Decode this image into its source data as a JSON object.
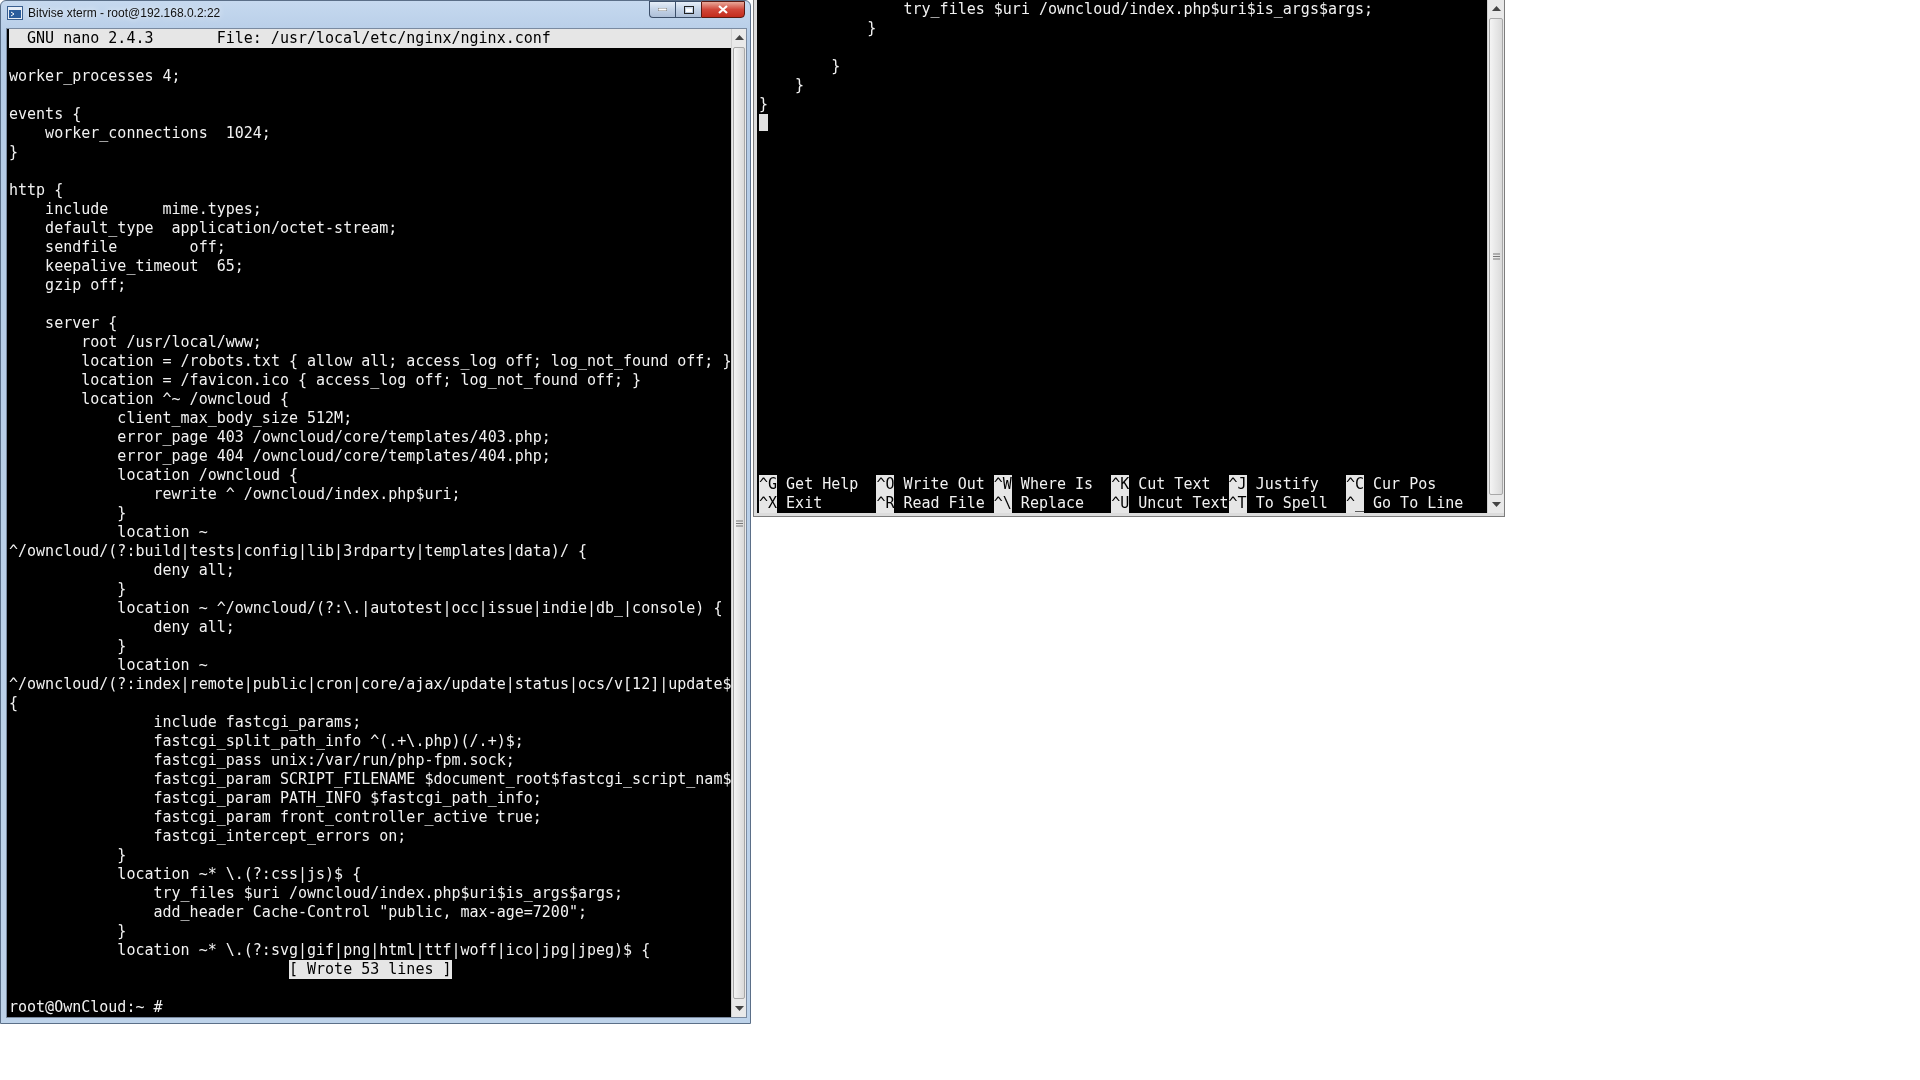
{
  "window": {
    "title": "Bitvise xterm - root@192.168.0.2:22"
  },
  "left_terminal": {
    "header": {
      "program": "GNU nano 2.4.3",
      "file": "File: /usr/local/etc/nginx/nginx.conf"
    },
    "blocks": [
      [
        "worker_processes 4;"
      ],
      [
        "events {",
        "    worker_connections  1024;",
        "}"
      ],
      [
        "http {",
        "    include      mime.types;",
        "    default_type  application/octet-stream;",
        "    sendfile        off;",
        "    keepalive_timeout  65;",
        "    gzip off;"
      ],
      [
        "    server {",
        "        root /usr/local/www;",
        "        location = /robots.txt { allow all; access_log off; log_not_found off; }",
        "        location = /favicon.ico { access_log off; log_not_found off; }",
        "        location ^~ /owncloud {",
        "            client_max_body_size 512M;",
        "            error_page 403 /owncloud/core/templates/403.php;",
        "            error_page 404 /owncloud/core/templates/404.php;",
        "            location /owncloud {",
        "                rewrite ^ /owncloud/index.php$uri;",
        "            }",
        "            location ~",
        "^/owncloud/(?:build|tests|config|lib|3rdparty|templates|data)/ {",
        "                deny all;",
        "            }",
        "            location ~ ^/owncloud/(?:\\.|autotest|occ|issue|indie|db_|console) {",
        "                deny all;",
        "            }",
        "            location ~",
        "^/owncloud/(?:index|remote|public|cron|core/ajax/update|status|ocs/v[12]|update$",
        "{",
        "                include fastcgi_params;",
        "                fastcgi_split_path_info ^(.+\\.php)(/.+)$;",
        "                fastcgi_pass unix:/var/run/php-fpm.sock;",
        "                fastcgi_param SCRIPT_FILENAME $document_root$fastcgi_script_nam$",
        "                fastcgi_param PATH_INFO $fastcgi_path_info;",
        "                fastcgi_param front_controller_active true;",
        "                fastcgi_intercept_errors on;",
        "            }",
        "            location ~* \\.(?:css|js)$ {",
        "                try_files $uri /owncloud/index.php$uri$is_args$args;",
        "                add_header Cache-Control \"public, max-age=7200\";",
        "            }",
        "            location ~* \\.(?:svg|gif|png|html|ttf|woff|ico|jpg|jpeg)$ {"
      ]
    ],
    "status_message": "[ Wrote 53 lines ]",
    "prompt": "root@OwnCloud:~ #"
  },
  "right_terminal": {
    "blocks": [
      [
        "                try_files $uri /owncloud/index.php$uri$is_args$args;",
        "            }"
      ],
      [
        "        }",
        "    }",
        "}"
      ]
    ],
    "shortcut_rows": [
      [
        {
          "key": "^G",
          "label": "Get Help"
        },
        {
          "key": "^O",
          "label": "Write Out"
        },
        {
          "key": "^W",
          "label": "Where Is"
        },
        {
          "key": "^K",
          "label": "Cut Text"
        },
        {
          "key": "^J",
          "label": "Justify"
        },
        {
          "key": "^C",
          "label": "Cur Pos"
        }
      ],
      [
        {
          "key": "^X",
          "label": "Exit"
        },
        {
          "key": "^R",
          "label": "Read File"
        },
        {
          "key": "^\\",
          "label": "Replace"
        },
        {
          "key": "^U",
          "label": "Uncut Text"
        },
        {
          "key": "^T",
          "label": "To Spell"
        },
        {
          "key": "^_",
          "label": "Go To Line"
        }
      ]
    ]
  }
}
